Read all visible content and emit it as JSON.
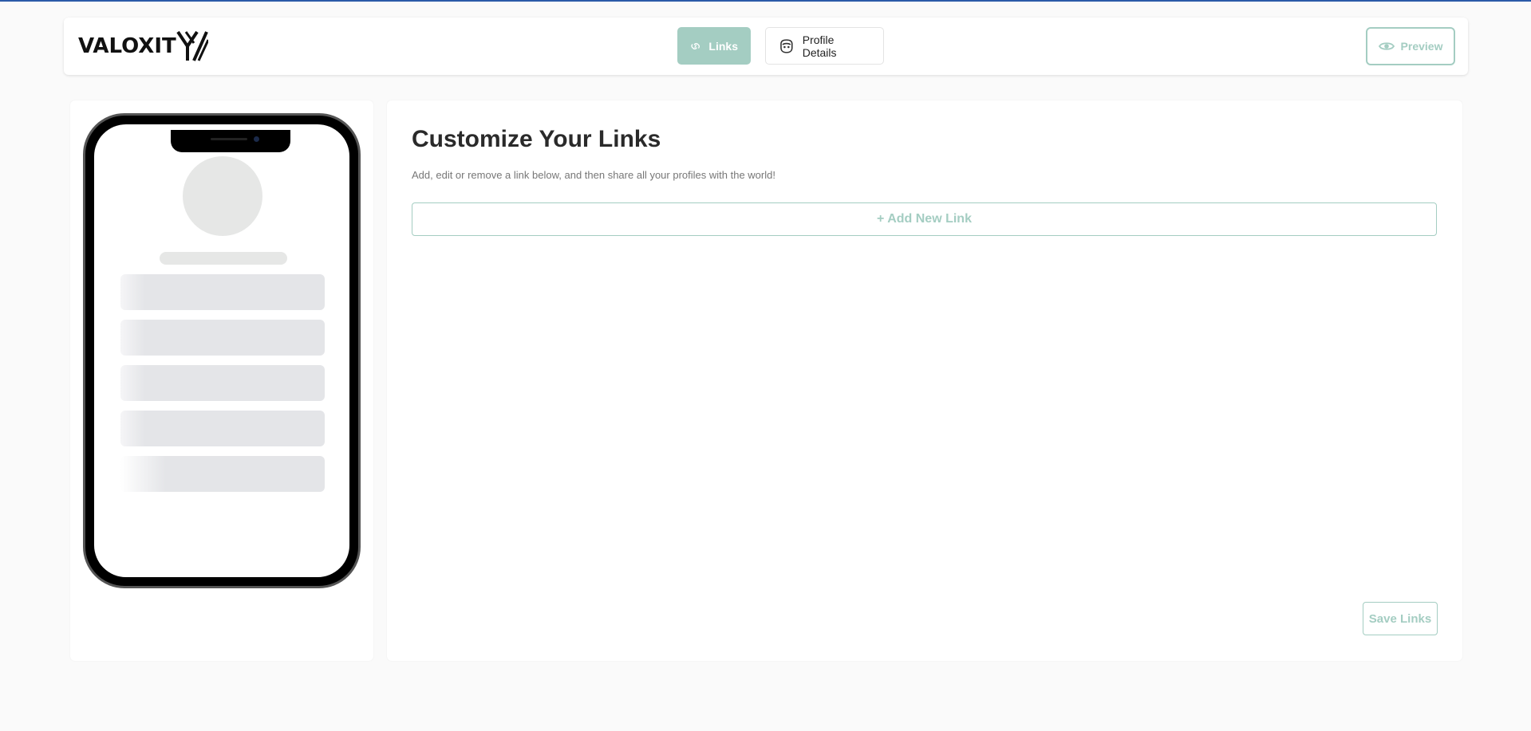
{
  "brand": {
    "name": "VALOXIT"
  },
  "nav": {
    "links_label": "Links",
    "profile_label": "Profile Details",
    "preview_label": "Preview"
  },
  "editor": {
    "title": "Customize Your Links",
    "description": "Add, edit or remove a link below, and then share all your profiles with the world!",
    "add_link_label": "+ Add New Link",
    "save_label": "Save Links"
  },
  "colors": {
    "accent": "#a4cdc2",
    "header_border": "#2b5aa8",
    "placeholder": "#e4e5e8"
  },
  "icons": {
    "links": "link-icon",
    "profile": "profile-face-icon",
    "preview": "eye-icon"
  }
}
